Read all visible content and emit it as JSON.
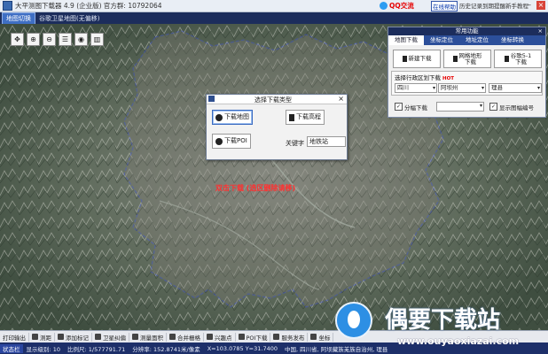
{
  "window": {
    "title": "大平测图下载器 4.9 (企业版)  官方群: 10792064",
    "qq_label": "QQ交流",
    "top_buttons": [
      "历史记录",
      "到期提醒",
      "新手教程",
      "帮助说明"
    ],
    "highlight_button": "在线帮助"
  },
  "tabs": [
    "地图切换",
    "谷歌卫星地图(无偏移)"
  ],
  "map": {
    "tool_icons": [
      "pointer-icon",
      "zoom-in-icon",
      "zoom-out-icon",
      "pan-icon",
      "globe-icon",
      "trash-icon"
    ],
    "red_text": "双击下载 (选区删除请移)",
    "boundary_color": "#3a4fff"
  },
  "dialog": {
    "title": "选择下载类型",
    "btn_map": "下载地图",
    "btn_elev": "下载高程",
    "btn_poi": "下载POI",
    "keyword_label": "关键字",
    "keyword_value": "地铁站"
  },
  "right_panel": {
    "title": "常用功能",
    "tabs": [
      "地图下载",
      "坐标定位",
      "地址定位",
      "坐标转换"
    ],
    "btn_new": "新建下载",
    "btn_grid": "网格地形\n下载",
    "btn_one": "谷歌5-1\n下载",
    "region_label": "选择行政区划下载",
    "hot": "HOT",
    "province": "四川",
    "city": "阿坝州",
    "county": "理县",
    "check_split": "分幅下载",
    "check_show": "显示图幅编号"
  },
  "bottom_toolbar": [
    "打印输出",
    "测距",
    "添加标记",
    "卫星纠偏",
    "测量面积",
    "合并栅格",
    "兴趣点",
    "POI下载",
    "服务发布",
    "坐标"
  ],
  "statusbar": {
    "label": "状态栏",
    "label2": "下载级别",
    "level": "显示级别: 10",
    "scale": "比例尺: 1/577791.71",
    "resolution": "分辨率: 152.8741米/像素",
    "coords": "X=103.0785  Y=31.7400",
    "region": "中国, 四川省, 阿坝藏族羌族自治州, 理县"
  },
  "watermark": {
    "text": "偶要下载站",
    "url": "www.ouyaoxiazai.com"
  }
}
